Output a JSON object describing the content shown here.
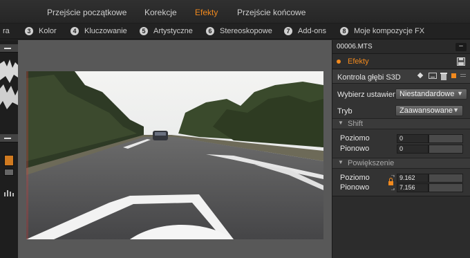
{
  "top_tabs": [
    {
      "label": "Przejście początkowe"
    },
    {
      "label": "Korekcje"
    },
    {
      "label": "Efekty"
    },
    {
      "label": "Przejście końcowe"
    }
  ],
  "sub_nav": [
    {
      "num": "",
      "label": "ra"
    },
    {
      "num": "3",
      "label": "Kolor"
    },
    {
      "num": "4",
      "label": "Kluczowanie"
    },
    {
      "num": "5",
      "label": "Artystyczne"
    },
    {
      "num": "6",
      "label": "Stereoskopowe"
    },
    {
      "num": "7",
      "label": "Add-ons"
    },
    {
      "num": "8",
      "label": "Moje kompozycje FX"
    }
  ],
  "panel": {
    "filename": "00006.MTS",
    "effects_label": "Efekty",
    "effect_name": "Kontrola głębi S3D",
    "preset_label": "Wybierz ustawien",
    "preset_value": "Niestandardowe",
    "mode_label": "Tryb",
    "mode_value": "Zaawansowane",
    "shift": {
      "title": "Shift",
      "horizontal_label": "Poziomo",
      "horizontal_value": "0",
      "vertical_label": "Pionowo",
      "vertical_value": "0"
    },
    "zoom": {
      "title": "Powiększenie",
      "horizontal_label": "Poziomo",
      "horizontal_value": "9.162",
      "vertical_label": "Pionowo",
      "vertical_value": "7.156"
    }
  },
  "colors": {
    "accent": "#f28a1e",
    "panel_bg": "#333333",
    "preview_bg": "#585858"
  }
}
